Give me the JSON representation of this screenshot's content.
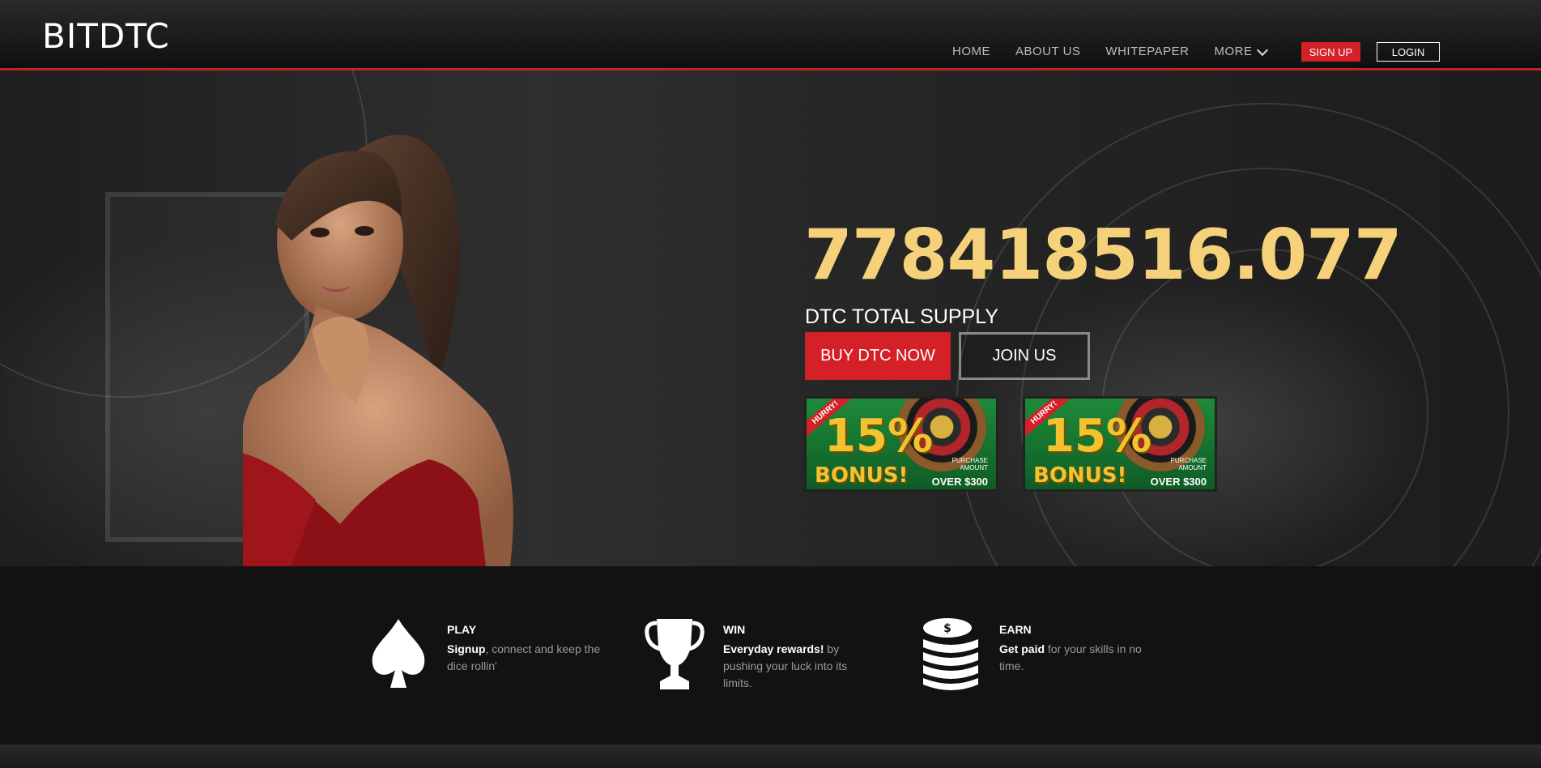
{
  "header": {
    "logo": "BITDTC",
    "nav": [
      {
        "label": "HOME"
      },
      {
        "label": "ABOUT US"
      },
      {
        "label": "WHITEPAPER"
      },
      {
        "label": "MORE"
      }
    ],
    "signup_label": "SIGN UP",
    "login_label": "LOGIN",
    "accent_color": "#c81e28"
  },
  "hero": {
    "counter": "778418516.077",
    "counter_color": "#f5d17a",
    "supply_label": "DTC TOTAL SUPPLY",
    "buy_label": "BUY DTC NOW",
    "join_label": "JOIN US",
    "banners": [
      {
        "hurry": "HURRY!",
        "percent": "15%",
        "bonus": "BONUS!",
        "purchase": "PURCHASE AMOUNT",
        "over": "OVER $300"
      },
      {
        "hurry": "HURRY!",
        "percent": "15%",
        "bonus": "BONUS!",
        "purchase": "PURCHASE AMOUNT",
        "over": "OVER $300"
      }
    ]
  },
  "features": [
    {
      "icon": "spade-icon",
      "title": "PLAY",
      "lead": "Signup",
      "text": ", connect and keep the dice rollin'"
    },
    {
      "icon": "trophy-icon",
      "title": "WIN",
      "lead": "Everyday rewards!",
      "text": " by pushing your luck into its limits."
    },
    {
      "icon": "coins-icon",
      "title": "EARN",
      "lead": "Get paid",
      "text": " for your skills in no time."
    }
  ]
}
